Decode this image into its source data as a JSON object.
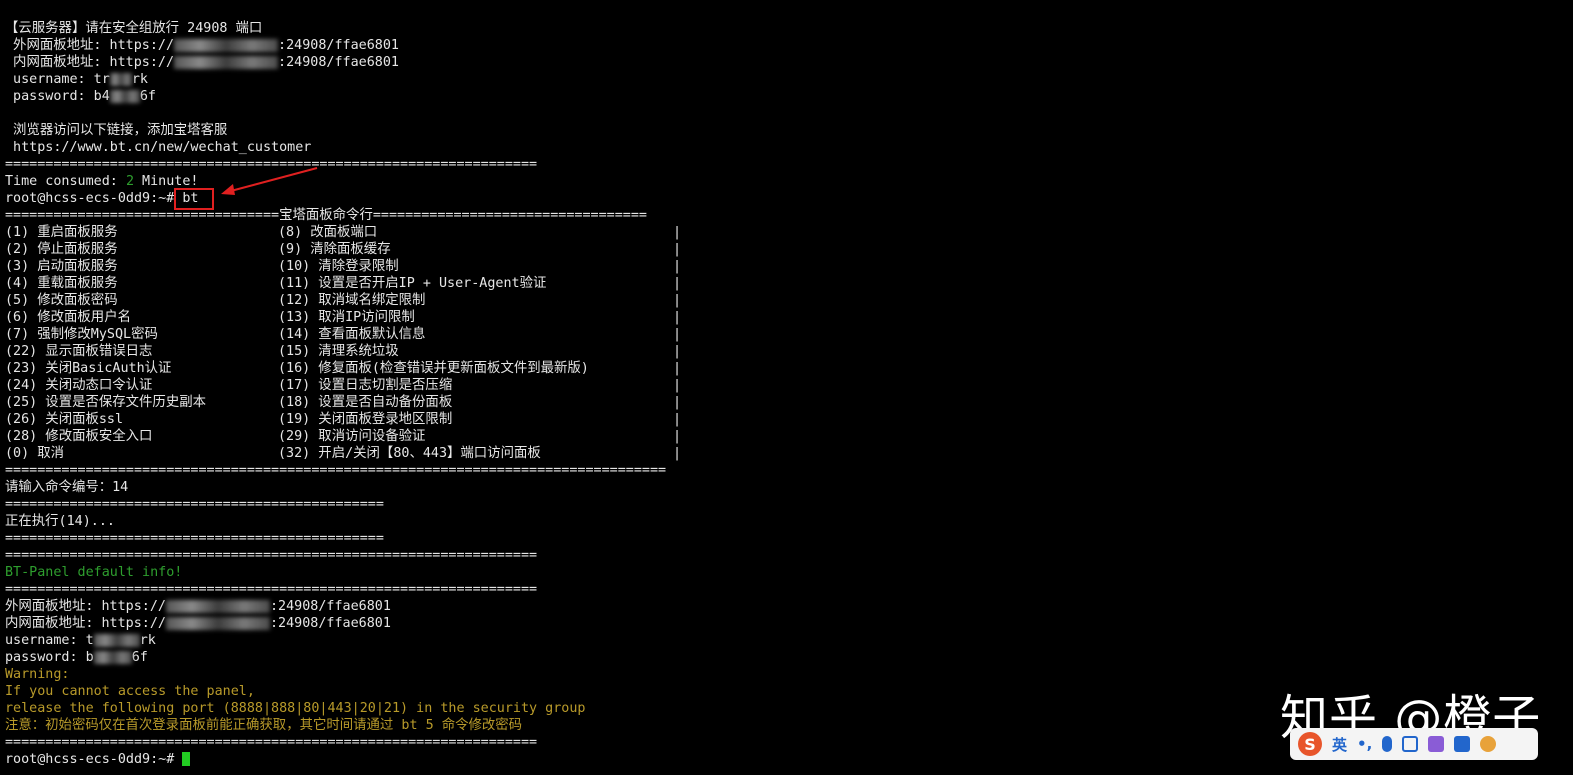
{
  "header": {
    "title": "【云服务器】请在安全组放行 24908 端口",
    "ext_label": " 外网面板地址: https://",
    "ext_suffix": ":24908/ffae6801",
    "int_label": " 内网面板地址: https://",
    "int_suffix": ":24908/ffae6801",
    "username_label": " username: tr",
    "username_suffix": "rk",
    "password_label": " password: b4",
    "password_suffix": "6f",
    "browser_hint": " 浏览器访问以下链接，添加宝塔客服",
    "customer_url": " https://www.bt.cn/new/wechat_customer",
    "rule1": "==================================================================",
    "time_label": "Time consumed: ",
    "time_value": "2",
    "time_unit": " Minute!",
    "prompt": "root@hcss-ecs-0dd9:~# ",
    "command": "bt"
  },
  "menu": {
    "top_left": "==================================",
    "title": "宝塔面板命令行",
    "top_right": "==================================",
    "bottom_rule": "==================================================================================",
    "left": [
      "(1) 重启面板服务",
      "(2) 停止面板服务",
      "(3) 启动面板服务",
      "(4) 重载面板服务",
      "(5) 修改面板密码",
      "(6) 修改面板用户名",
      "(7) 强制修改MySQL密码",
      "(22) 显示面板错误日志",
      "(23) 关闭BasicAuth认证",
      "(24) 关闭动态口令认证",
      "(25) 设置是否保存文件历史副本",
      "(26) 关闭面板ssl",
      "(28) 修改面板安全入口",
      "(0) 取消"
    ],
    "right": [
      "(8) 改面板端口",
      "(9) 清除面板缓存",
      "(10) 清除登录限制",
      "(11) 设置是否开启IP + User-Agent验证",
      "(12) 取消域名绑定限制",
      "(13) 取消IP访问限制",
      "(14) 查看面板默认信息",
      "(15) 清理系统垃圾",
      "(16) 修复面板(检查错误并更新面板文件到最新版)",
      "(17) 设置日志切割是否压缩",
      "(18) 设置是否自动备份面板",
      "(19) 关闭面板登录地区限制",
      "(29) 取消访问设备验证",
      "(32) 开启/关闭【80、443】端口访问面板"
    ],
    "bar": "|"
  },
  "exec": {
    "input_prompt": "请输入命令编号：14",
    "rule_short": "===============================================",
    "running": "正在执行(14)...",
    "rule_long": "==================================================================",
    "info_title": "BT-Panel default info!",
    "ext_label": "外网面板地址: https://",
    "ext_suffix": ":24908/ffae6801",
    "int_label": "内网面板地址: https://",
    "int_suffix": ":24908/ffae6801",
    "username_label": "username: t",
    "username_suffix": "rk",
    "password_label": "password: b",
    "password_suffix": "6f",
    "warning": "Warning:",
    "warning_l1": "If you cannot access the panel,",
    "warning_l2": "release the following port (8888|888|80|443|20|21) in the security group",
    "notice": "注意：初始密码仅在首次登录面板前能正确获取，其它时间请通过 bt 5 命令修改密码",
    "final_prompt": "root@hcss-ecs-0dd9:~# "
  },
  "watermark": {
    "text": "知乎 @橙子"
  },
  "ime": {
    "logo": "S",
    "lang": "英",
    "punct": "•,"
  },
  "colors": {
    "green": "#2e9e2e",
    "yellow": "#b89a2a",
    "annotation": "#e02020",
    "cursor": "#22cc22"
  }
}
